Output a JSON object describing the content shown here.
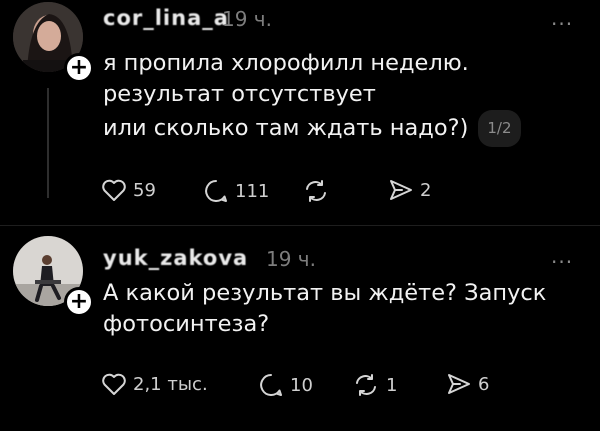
{
  "posts": [
    {
      "username": "сor_lina_a",
      "time": "19 ч.",
      "more": "...",
      "lines": [
        "я пропила хлорофилл неделю.",
        "результат отсутствует",
        "или сколько там ждать надо?)"
      ],
      "page_badge": "1/2",
      "likes": "59",
      "comments": "111",
      "reposts": "",
      "shares": "2"
    },
    {
      "username": "yuk_zakova",
      "time": "19 ч.",
      "more": "...",
      "lines": [
        "А какой результат вы ждёте? Запуск",
        "фотосинтеза?"
      ],
      "likes": "2,1 тыс.",
      "comments": "10",
      "reposts": "1",
      "shares": "6"
    }
  ],
  "icons": [
    "heart-icon",
    "comment-icon",
    "repost-icon",
    "share-icon",
    "plus-icon",
    "more-icon"
  ]
}
